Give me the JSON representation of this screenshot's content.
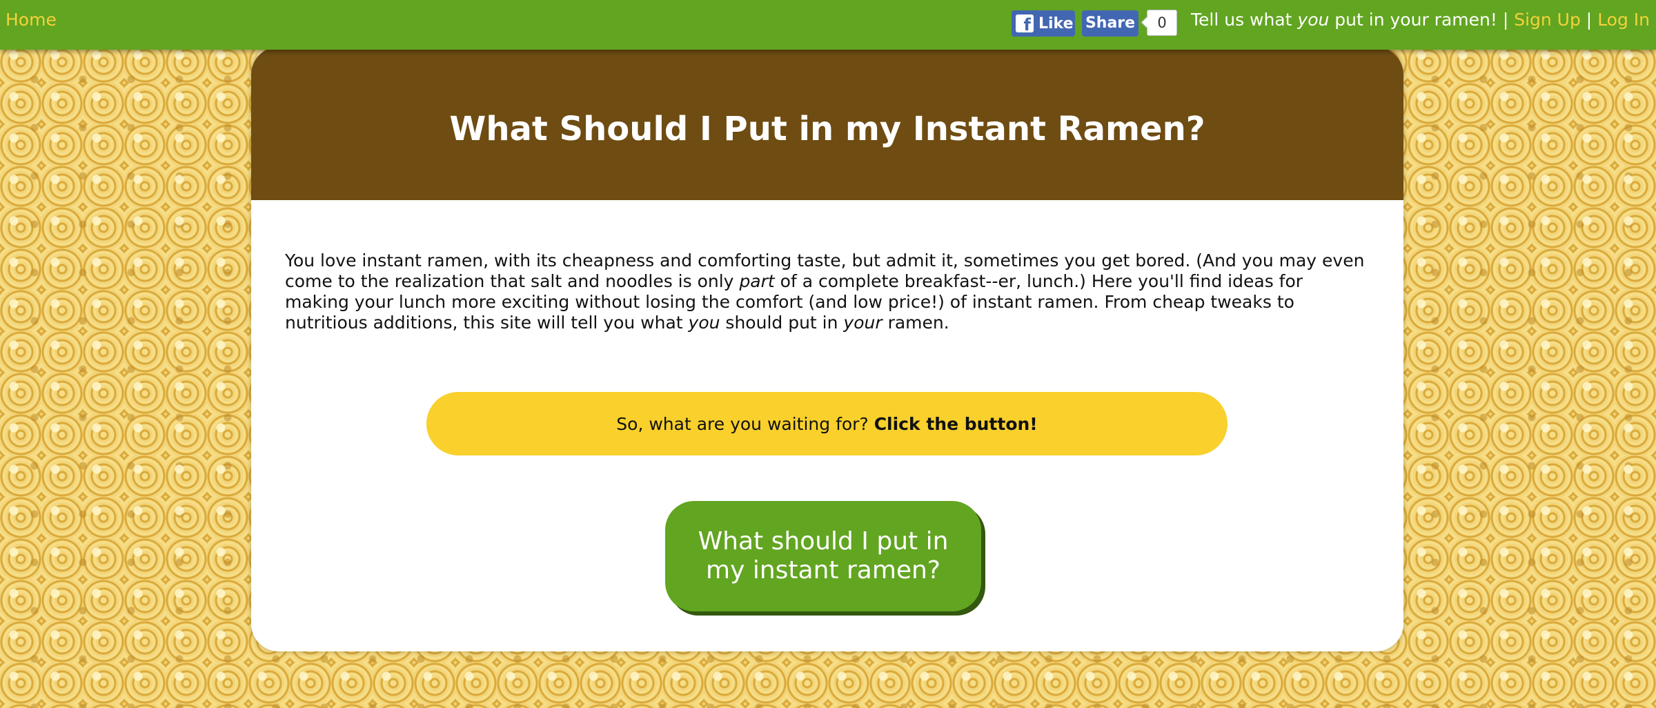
{
  "nav": {
    "home_label": "Home",
    "facebook": {
      "like_label": "Like",
      "share_label": "Share",
      "share_count": "0"
    },
    "tagline_prefix": "Tell us what ",
    "tagline_emphasis": "you",
    "tagline_suffix": " put in your ramen!",
    "separator": " | ",
    "signup_label": "Sign Up",
    "login_label": "Log In"
  },
  "main": {
    "title": "What Should I Put in my Instant Ramen?",
    "intro": {
      "part1": "You love instant ramen, with its cheapness and comforting taste, but admit it, sometimes you get bored. (And you may even come to the realization that salt and noodles is only ",
      "em1": "part",
      "part2": " of a complete breakfast--er, lunch.) Here you'll find ideas for making your lunch more exciting without losing the comfort (and low price!) of instant ramen. From cheap tweaks to nutritious additions, this site will tell you what ",
      "em2": "you",
      "part3": " should put in ",
      "em3": "your",
      "part4": " ramen."
    },
    "cta_text": "So, what are you waiting for? ",
    "cta_bold": "Click the button!",
    "button_label": "What should I put in my instant ramen?"
  },
  "colors": {
    "nav_green": "#62a521",
    "header_brown": "#6e4c12",
    "accent_yellow": "#f4d23a",
    "banner_yellow": "#f9d02c",
    "facebook_blue": "#4267b2"
  },
  "icons": {
    "facebook": "facebook-f-icon"
  }
}
